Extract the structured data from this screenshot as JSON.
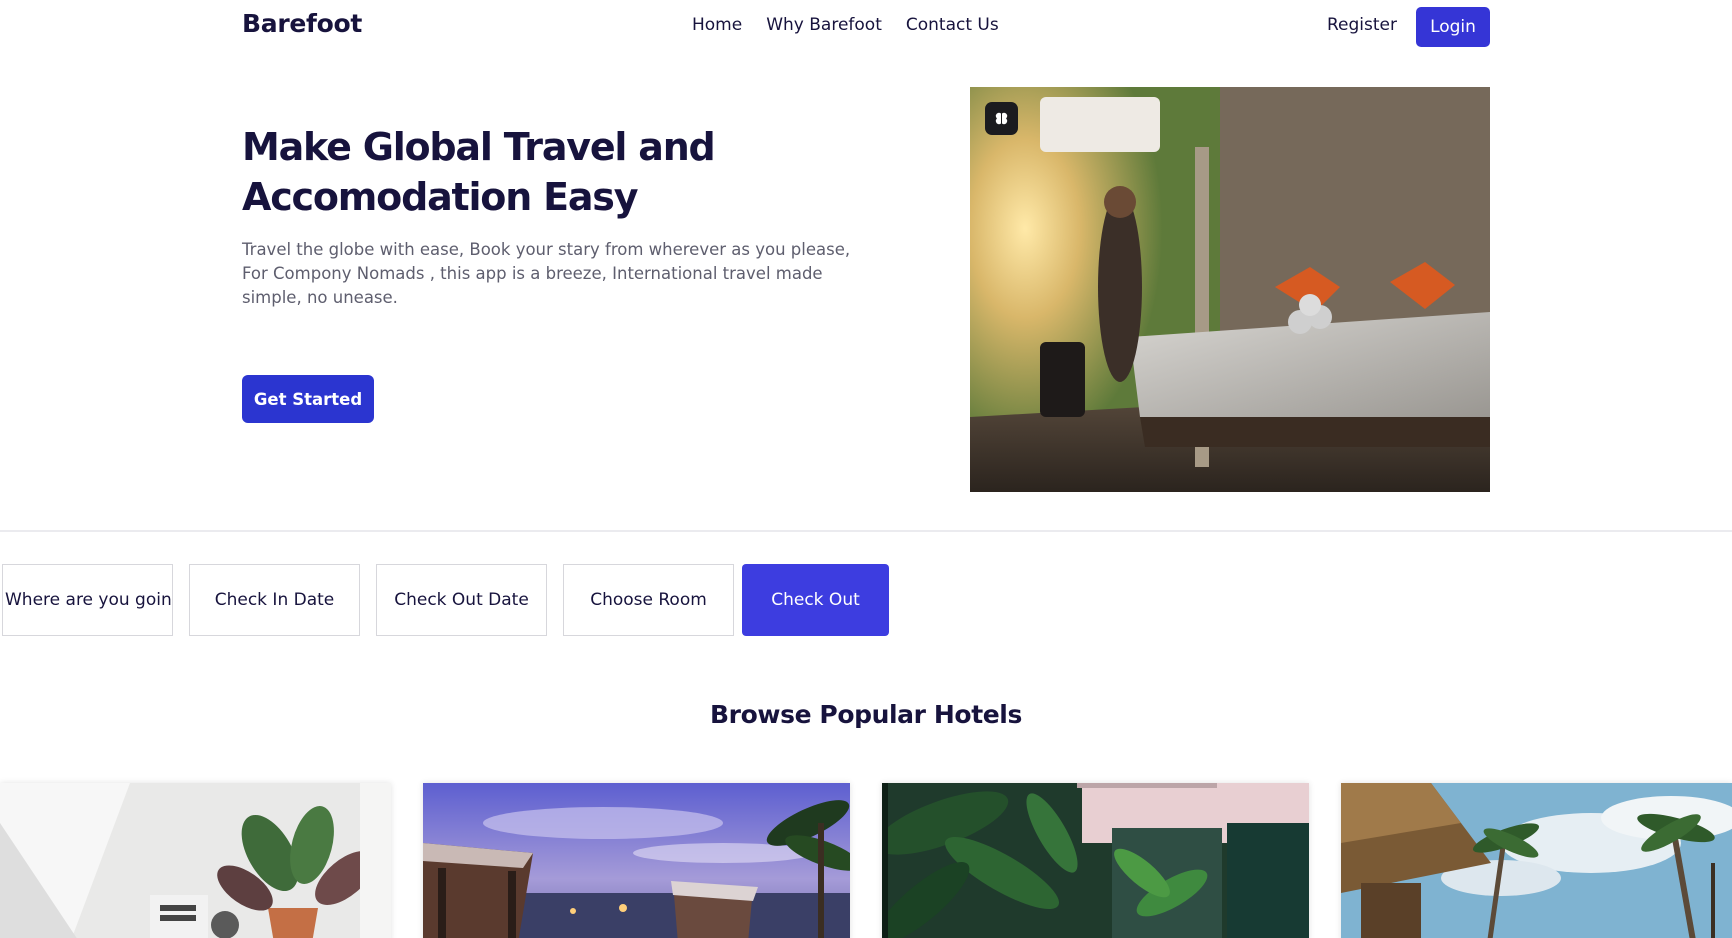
{
  "nav": {
    "brand": "Barefoot",
    "links": [
      "Home",
      "Why Barefoot",
      "Contact Us"
    ],
    "register_label": "Register",
    "login_label": "Login"
  },
  "hero": {
    "title_line1": "Make Global Travel and",
    "title_line2": "Accomodation Easy",
    "text": "Travel the globe with ease, Book your stary from wherever as you please, For Compony Nomads , this app is a breeze, International travel made simple, no unease.",
    "cta_label": "Get Started",
    "image_icon": "hotel-room-photo",
    "badge_icon": "ai-brain-icon"
  },
  "search": {
    "destination_placeholder": "Where are you going?",
    "check_in_label": "Check In Date",
    "check_out_date_label": "Check Out Date",
    "room_label": "Choose Room",
    "submit_label": "Check Out"
  },
  "popular": {
    "title": "Browse Popular Hotels",
    "hotels": [
      {
        "image_icon": "room-with-plant-photo"
      },
      {
        "image_icon": "beach-cabana-sunset-photo"
      },
      {
        "image_icon": "tropical-courtyard-photo"
      },
      {
        "image_icon": "palm-beach-hut-photo"
      }
    ]
  },
  "colors": {
    "primary": "#3535d6",
    "heading": "#17133d",
    "body_text": "#5e5e6e"
  }
}
